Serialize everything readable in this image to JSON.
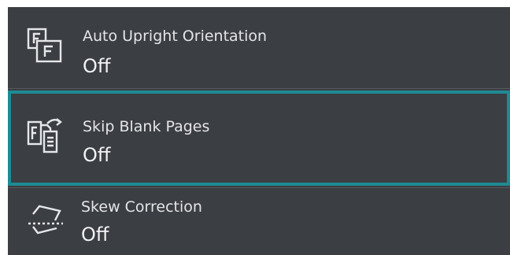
{
  "settings": {
    "items": [
      {
        "title": "Auto Upright Orientation",
        "value": "Off",
        "icon": "auto-upright-orientation-icon",
        "selected": false
      },
      {
        "title": "Skip Blank Pages",
        "value": "Off",
        "icon": "skip-blank-pages-icon",
        "selected": true
      },
      {
        "title": "Skew Correction",
        "value": "Off",
        "icon": "skew-correction-icon",
        "selected": false
      }
    ]
  },
  "colors": {
    "panel_background": "#3b3e43",
    "selected_border": "#1e8b93",
    "text": "#e4e5e7"
  }
}
